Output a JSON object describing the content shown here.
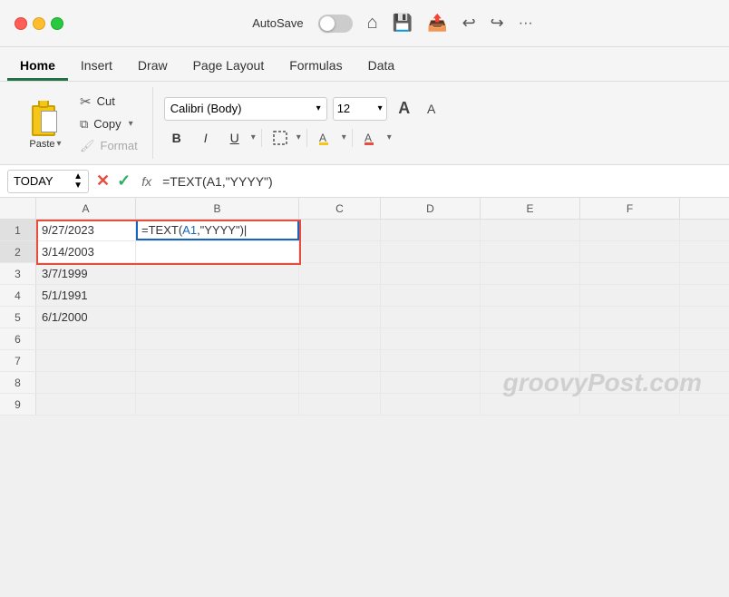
{
  "titlebar": {
    "autosave_label": "AutoSave",
    "more_options": "···"
  },
  "tabs": [
    {
      "label": "Home",
      "active": true
    },
    {
      "label": "Insert",
      "active": false
    },
    {
      "label": "Draw",
      "active": false
    },
    {
      "label": "Page Layout",
      "active": false
    },
    {
      "label": "Formulas",
      "active": false
    },
    {
      "label": "Data",
      "active": false
    }
  ],
  "clipboard": {
    "paste_label": "Paste",
    "cut_label": "Cut",
    "copy_label": "Copy",
    "format_label": "Format"
  },
  "font": {
    "name": "Calibri (Body)",
    "size": "12",
    "dropdown_arrow": "▾"
  },
  "formula_bar": {
    "name_box": "TODAY",
    "cancel": "✕",
    "confirm": "✓",
    "fx": "fx",
    "formula": "=TEXT(A1,\"YYYY\")"
  },
  "columns": [
    "A",
    "B",
    "C",
    "D",
    "E",
    "F"
  ],
  "rows": [
    {
      "num": "1",
      "a": "9/27/2023",
      "b": "=TEXT(A1,\"YYYY\")",
      "c": "",
      "d": "",
      "e": "",
      "f": ""
    },
    {
      "num": "2",
      "a": "3/14/2003",
      "b": "",
      "c": "",
      "d": "",
      "e": "",
      "f": ""
    },
    {
      "num": "3",
      "a": "3/7/1999",
      "b": "",
      "c": "",
      "d": "",
      "e": "",
      "f": ""
    },
    {
      "num": "4",
      "a": "5/1/1991",
      "b": "",
      "c": "",
      "d": "",
      "e": "",
      "f": ""
    },
    {
      "num": "5",
      "a": "6/1/2000",
      "b": "",
      "c": "",
      "d": "",
      "e": "",
      "f": ""
    },
    {
      "num": "6",
      "a": "",
      "b": "",
      "c": "",
      "d": "",
      "e": "",
      "f": ""
    },
    {
      "num": "7",
      "a": "",
      "b": "",
      "c": "",
      "d": "",
      "e": "",
      "f": ""
    },
    {
      "num": "8",
      "a": "",
      "b": "",
      "c": "",
      "d": "",
      "e": "",
      "f": ""
    },
    {
      "num": "9",
      "a": "",
      "b": "",
      "c": "",
      "d": "",
      "e": "",
      "f": ""
    }
  ],
  "watermark": "groovyPost.com"
}
